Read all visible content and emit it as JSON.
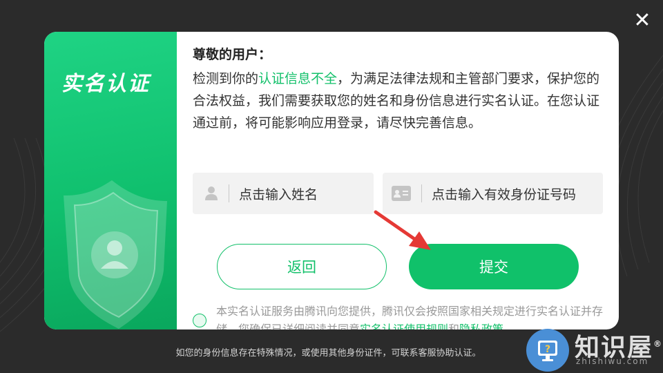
{
  "dialog": {
    "side_title": "实名认证",
    "greeting": "尊敬的用户：",
    "para_pre": "检测到你的",
    "para_highlight": "认证信息不全",
    "para_post": "，为满足法律法规和主管部门要求，保护您的合法权益，我们需要获取您的姓名和身份信息进行实名认证。在您认证通过前，将可能影响应用登录，请尽快完善信息。",
    "name_field": {
      "placeholder": "点击输入姓名"
    },
    "id_field": {
      "placeholder": "点击输入有效身份证号码"
    },
    "back_label": "返回",
    "submit_label": "提交",
    "agreement": {
      "text_pre": "本实名认证服务由腾讯向您提供，腾讯仅会按照国家相关规定进行实名认证并存储，您确保已详细阅读并同意",
      "link1": "实名认证使用规则",
      "and": "和",
      "link2": "隐私政策"
    }
  },
  "close_icon": "close-icon",
  "footer": "如您的身份信息存在特殊情况，或使用其他身份证件，可联系客服协助认证。",
  "watermark": {
    "text": "知识屋",
    "sub": "zhishiwu.com",
    "reg": "®"
  },
  "colors": {
    "accent": "#12c06a",
    "background": "#2b2b2b"
  }
}
